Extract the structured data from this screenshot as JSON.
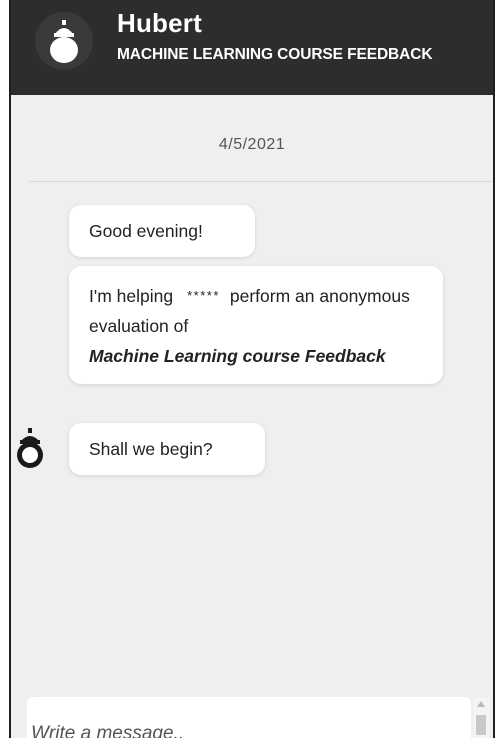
{
  "header": {
    "bot_name": "Hubert",
    "subtitle": "MACHINE LEARNING COURSE FEEDBACK",
    "avatar_icon": "robot-icon"
  },
  "conversation": {
    "date": "4/5/2021",
    "messages": [
      {
        "text": "Good evening!"
      },
      {
        "prefix": "I'm helping",
        "masked_name": "*****",
        "middle": "perform an anonymous evaluation of",
        "course": "Machine Learning course Feedback"
      },
      {
        "text": "Shall we begin?"
      }
    ]
  },
  "composer": {
    "placeholder": "Write a message.."
  },
  "colors": {
    "header_bg": "#2d2d2d",
    "chat_bg": "#efefef",
    "bubble_bg": "#ffffff"
  }
}
